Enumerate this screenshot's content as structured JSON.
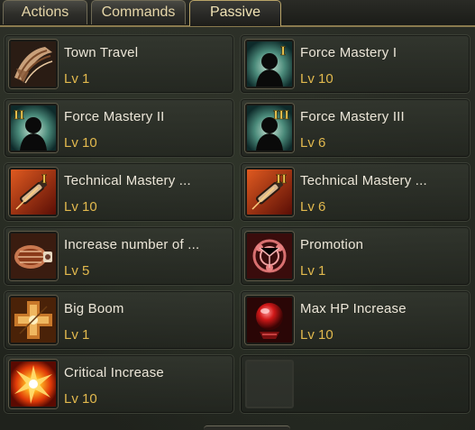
{
  "tabs": [
    {
      "label": "Actions",
      "active": false
    },
    {
      "label": "Commands",
      "active": false
    },
    {
      "label": "Passive",
      "active": true
    }
  ],
  "skills": [
    {
      "name": "Town Travel",
      "level": "Lv 1",
      "icon": "town-travel-icon",
      "tier": ""
    },
    {
      "name": "Force Mastery I",
      "level": "Lv 10",
      "icon": "force-mastery-icon",
      "tier": "I"
    },
    {
      "name": "Force Mastery II",
      "level": "Lv 10",
      "icon": "force-mastery-icon",
      "tier": "II"
    },
    {
      "name": "Force Mastery III",
      "level": "Lv 6",
      "icon": "force-mastery-icon",
      "tier": "III"
    },
    {
      "name": "Technical Mastery ...",
      "level": "Lv 10",
      "icon": "technical-mastery-icon",
      "tier": "I"
    },
    {
      "name": "Technical Mastery ...",
      "level": "Lv 6",
      "icon": "technical-mastery-icon",
      "tier": "II"
    },
    {
      "name": "Increase number of ...",
      "level": "Lv 5",
      "icon": "ammo-drum-icon",
      "tier": ""
    },
    {
      "name": "Promotion",
      "level": "Lv 1",
      "icon": "promotion-icon",
      "tier": ""
    },
    {
      "name": "Big Boom",
      "level": "Lv 1",
      "icon": "big-boom-icon",
      "tier": ""
    },
    {
      "name": "Max HP Increase",
      "level": "Lv 10",
      "icon": "max-hp-icon",
      "tier": ""
    },
    {
      "name": "Critical Increase",
      "level": "Lv 10",
      "icon": "critical-increase-icon",
      "tier": ""
    },
    {
      "name": "",
      "level": "",
      "icon": "empty-slot",
      "tier": ""
    }
  ],
  "colors": {
    "skill_name": "#ece6d8",
    "skill_level": "#e2b94e",
    "tab_text": "#e6d6a8",
    "tab_active_border": "#b9a468"
  }
}
